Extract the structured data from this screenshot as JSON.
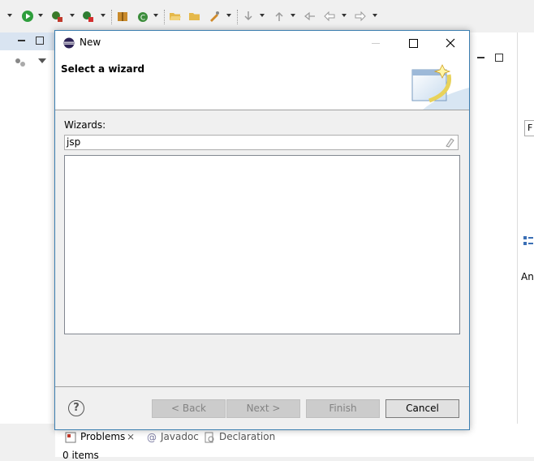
{
  "dialog": {
    "title": "New",
    "banner_title": "Select a wizard",
    "wizards_label": "Wizards:",
    "filter_value": "jsp",
    "buttons": {
      "back": "< Back",
      "next": "Next >",
      "finish": "Finish",
      "cancel": "Cancel",
      "help": "?"
    }
  },
  "bottom_tabs": [
    {
      "label": "Problems"
    },
    {
      "label": "Javadoc"
    },
    {
      "label": "Declaration"
    }
  ],
  "bottom_status": "0 items",
  "right_panel": {
    "label_fragment": "An",
    "field_fragment": "F"
  },
  "colors": {
    "dialog_border": "#3c7fb1",
    "accent": "#1a5fb4"
  }
}
